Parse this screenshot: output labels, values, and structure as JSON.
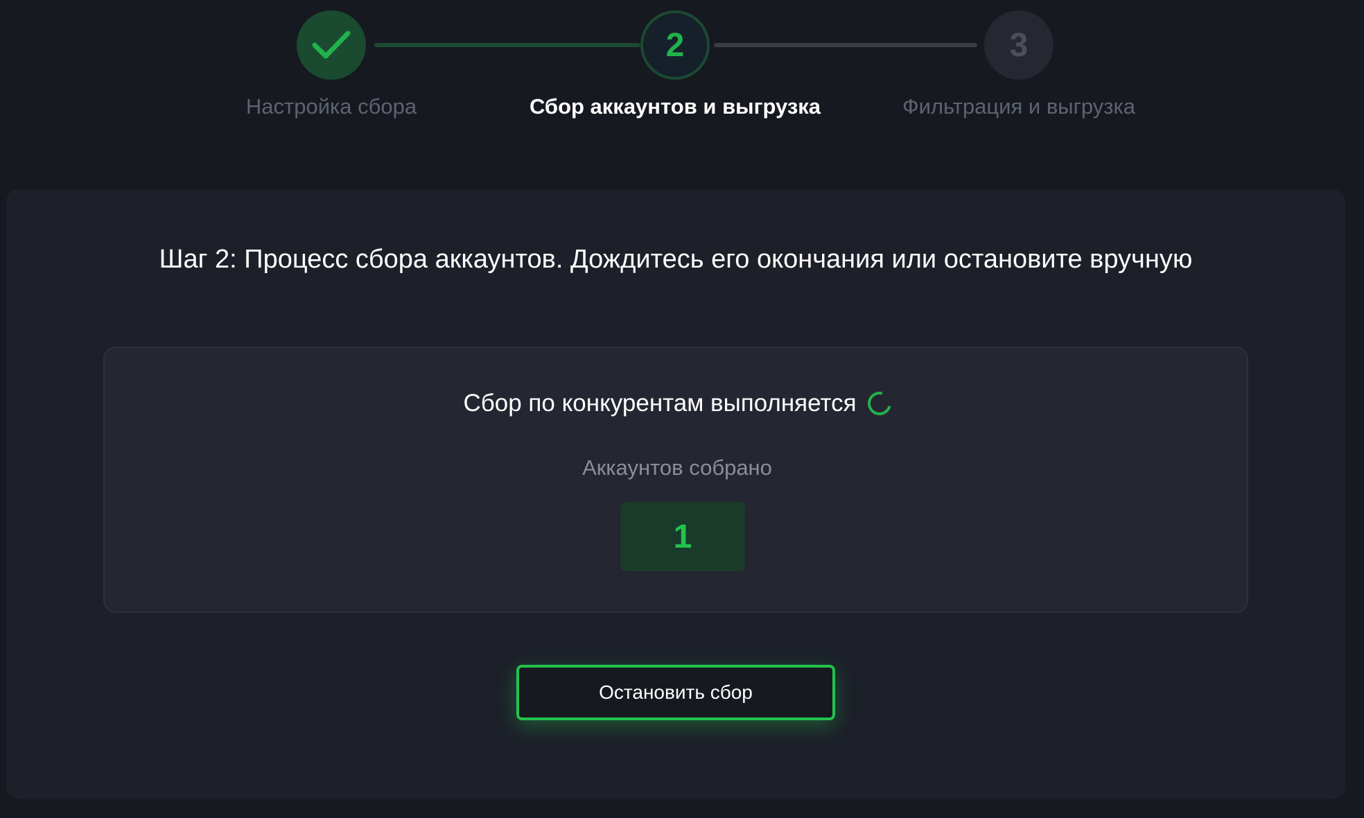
{
  "colors": {
    "background": "#161920",
    "card": "#1d2029",
    "inner_card": "#242631",
    "accent": "#22c24e",
    "step_done": "#1a4a2f",
    "step_pending": "#252830",
    "muted_text": "#5e6370"
  },
  "stepper": {
    "steps": [
      {
        "number": "",
        "label": "Настройка сбора",
        "state": "done",
        "icon": "check-icon"
      },
      {
        "number": "2",
        "label": "Сбор аккаунтов и выгрузка",
        "state": "active"
      },
      {
        "number": "3",
        "label": "Фильтрация и выгрузка",
        "state": "pending"
      }
    ]
  },
  "main": {
    "title": "Шаг 2: Процесс сбора аккаунтов. Дождитесь его окончания или остановите вручную",
    "status": {
      "text": "Сбор по конкурентам выполняется",
      "icon": "spinner-icon"
    },
    "counter": {
      "label": "Аккаунтов собрано",
      "value": "1"
    },
    "stop_button_label": "Остановить сбор"
  }
}
